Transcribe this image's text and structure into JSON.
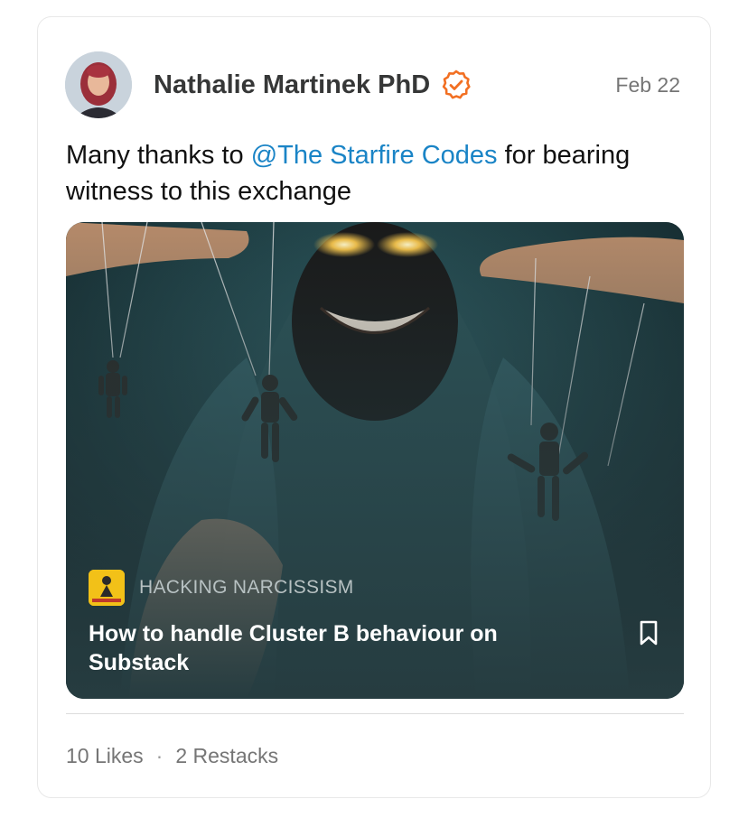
{
  "note": {
    "author": "Nathalie Martinek PhD",
    "date": "Feb 22",
    "text_before": "Many thanks to ",
    "mention": "@The Starfire Codes",
    "text_after": " for bearing witness to this exchange"
  },
  "embed": {
    "publication": "HACKING NARCISSISM",
    "title": "How to handle Cluster B behaviour on Substack"
  },
  "footer": {
    "likes": "10 Likes",
    "separator": "·",
    "restacks": "2 Restacks"
  },
  "colors": {
    "mention": "#1a84c6",
    "verified": "#f26f22",
    "embed_bg": "#263c40"
  },
  "icons": {
    "verified": "verified-badge-icon",
    "bookmark": "bookmark-icon"
  }
}
